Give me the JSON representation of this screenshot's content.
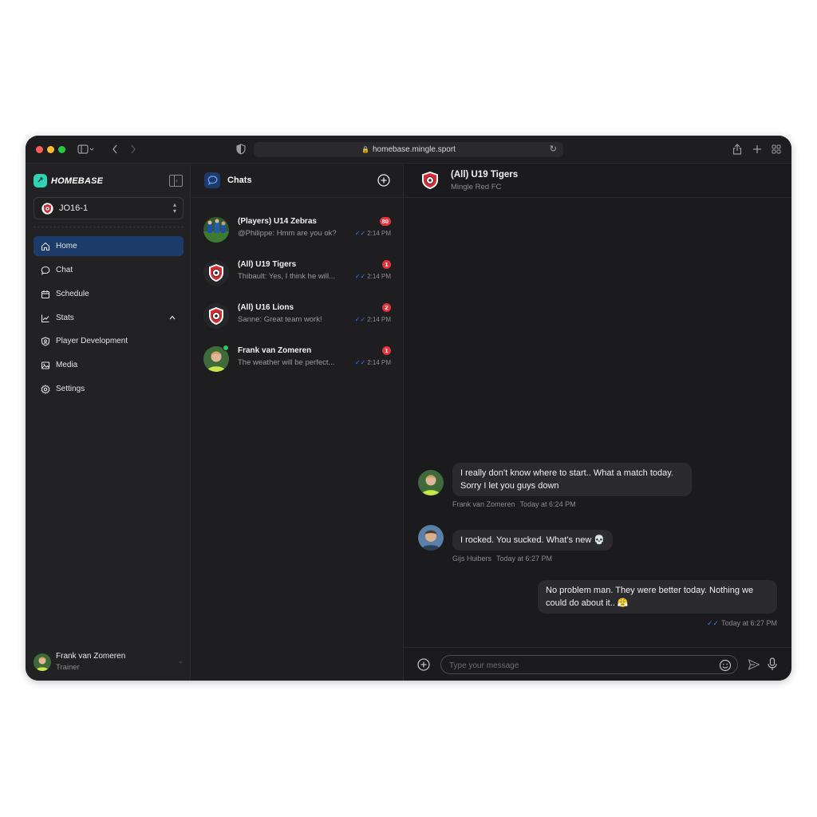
{
  "browser": {
    "url": "homebase.mingle.sport",
    "traffic_lights": [
      "#ff5f57",
      "#febc2e",
      "#28c840"
    ]
  },
  "sidebar": {
    "brand": "HOMEBASE",
    "team_select": "JO16-1",
    "items": [
      {
        "label": "Home",
        "icon": "home-icon",
        "active": true
      },
      {
        "label": "Chat",
        "icon": "chat-icon"
      },
      {
        "label": "Schedule",
        "icon": "calendar-icon"
      },
      {
        "label": "Stats",
        "icon": "stats-icon",
        "expanded": true
      },
      {
        "label": "Player Development",
        "icon": "shield-icon"
      },
      {
        "label": "Media",
        "icon": "media-icon"
      },
      {
        "label": "Settings",
        "icon": "gear-icon"
      }
    ],
    "user": {
      "name": "Frank van Zomeren",
      "role": "Trainer"
    }
  },
  "chats": {
    "title": "Chats",
    "items": [
      {
        "name": "(Players) U14 Zebras",
        "preview": "@Philippe: Hmm are you ok?",
        "badge": "80",
        "time": "2:14 PM"
      },
      {
        "name": "(All) U19 Tigers",
        "preview": "Thibault: Yes, I think he will...",
        "badge": "1",
        "time": "2:14 PM"
      },
      {
        "name": "(All) U16 Lions",
        "preview": "Sanne: Great team work!",
        "badge": "2",
        "time": "2:14 PM"
      },
      {
        "name": "Frank van Zomeren",
        "preview": "The weather will be perfect...",
        "badge": "1",
        "time": "2:14 PM",
        "online": true
      }
    ]
  },
  "conversation": {
    "title": "(All) U19 Tigers",
    "subtitle": "Mingle Red FC",
    "messages": [
      {
        "text": "I really don’t know where to start.. What a match today. Sorry I let you guys down",
        "author": "Frank van Zomeren",
        "time": "Today at 6:24 PM"
      },
      {
        "text": "I rocked. You sucked. What’s new 💀",
        "author": "Gijs Huibers",
        "time": "Today at 6:27 PM"
      },
      {
        "text": "No problem man. They were better today. Nothing we could do about it.. 😤",
        "time": "Today at 6:27 PM"
      }
    ],
    "composer": {
      "placeholder": "Type your message"
    }
  },
  "colors": {
    "accent": "#1c3a6a",
    "brand": "#2fd3b4",
    "badge": "#e5353b",
    "tick": "#3d7bff"
  }
}
